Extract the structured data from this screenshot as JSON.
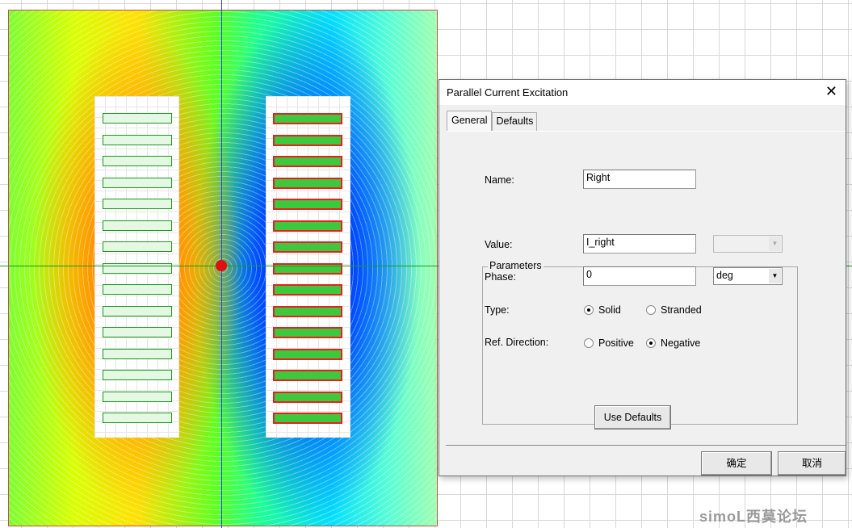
{
  "dialog": {
    "title": "Parallel Current Excitation",
    "tabs": [
      {
        "label": "General",
        "active": true
      },
      {
        "label": "Defaults",
        "active": false
      }
    ],
    "name_label": "Name:",
    "name_value": "Right",
    "group_label": "Parameters",
    "value_label": "Value:",
    "value_value": "I_right",
    "value_unit": "",
    "phase_label": "Phase:",
    "phase_value": "0",
    "phase_unit": "deg",
    "type_label": "Type:",
    "type_options": [
      "Solid",
      "Stranded"
    ],
    "type_selected": "Solid",
    "ref_label": "Ref. Direction:",
    "ref_options": [
      "Positive",
      "Negative"
    ],
    "ref_selected": "Negative",
    "use_defaults": "Use Defaults",
    "ok": "确定",
    "cancel": "取消"
  },
  "watermark": "simoL西莫论坛",
  "colors": {
    "left_coil_outline": "#1a9a1a",
    "right_coil_outline": "#e82020",
    "axis_v": "#2040ff",
    "axis_h": "#1a9a1a"
  }
}
